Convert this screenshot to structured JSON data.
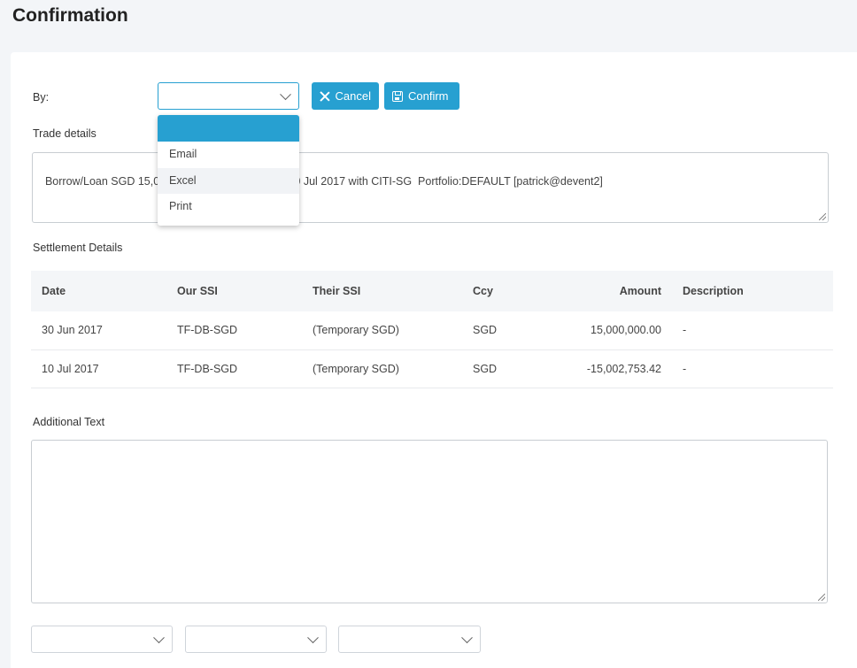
{
  "page": {
    "title": "Confirmation"
  },
  "form": {
    "by_label": "By:",
    "by_value": "",
    "cancel_label": "Cancel",
    "confirm_label": "Confirm",
    "trade_details_label": "Trade details",
    "trade_details_text": "Borrow/Loan SGD 15,000,000.00 30 Jun 2017 to 10 Jul 2017 with CITI-SG  Portfolio:DEFAULT [patrick@devent2]",
    "settlement_label": "Settlement Details",
    "additional_text_label": "Additional Text",
    "additional_text_value": ""
  },
  "dropdown": {
    "options": [
      "",
      "Email",
      "Excel",
      "Print"
    ],
    "selected_index": 0,
    "hover_index": 2
  },
  "settlement": {
    "columns": [
      "Date",
      "Our SSI",
      "Their SSI",
      "Ccy",
      "Amount",
      "Description"
    ],
    "rows": [
      {
        "date": "30 Jun 2017",
        "our_ssi": "TF-DB-SGD",
        "their_ssi": "(Temporary SGD)",
        "ccy": "SGD",
        "amount": "15,000,000.00",
        "description": "-"
      },
      {
        "date": "10 Jul 2017",
        "our_ssi": "TF-DB-SGD",
        "their_ssi": "(Temporary SGD)",
        "ccy": "SGD",
        "amount": "-15,002,753.42",
        "description": "-"
      }
    ]
  },
  "colors": {
    "accent": "#27a0d1",
    "positive": "#2a2ad0",
    "negative": "#e01b1b"
  }
}
